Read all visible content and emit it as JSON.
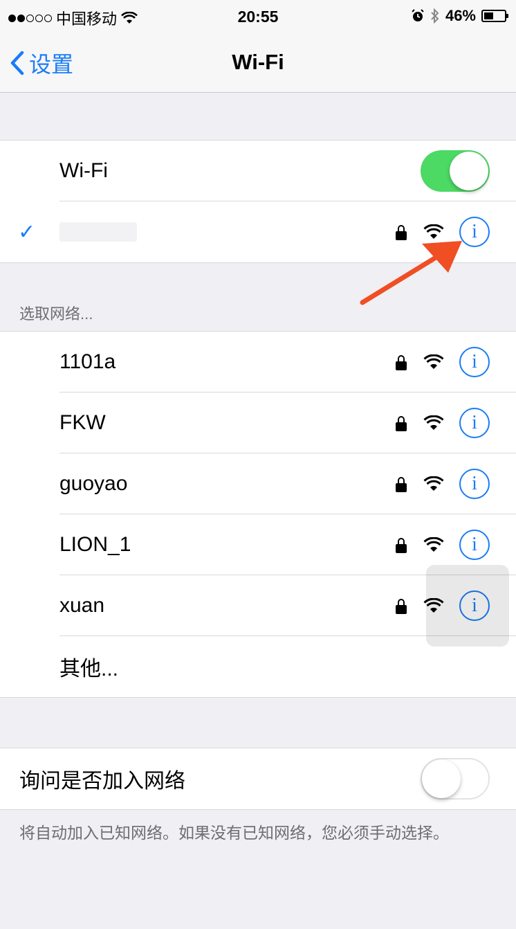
{
  "status_bar": {
    "carrier": "中国移动",
    "time": "20:55",
    "battery": "46%",
    "battery_level": 0.46
  },
  "nav": {
    "back_label": "设置",
    "title": "Wi-Fi"
  },
  "wifi_toggle": {
    "label": "Wi-Fi",
    "on": true
  },
  "connected": {
    "name_masked": true,
    "secured": true
  },
  "section_header": "选取网络...",
  "networks": [
    {
      "name": "1101a",
      "secured": true
    },
    {
      "name": "FKW",
      "secured": true
    },
    {
      "name": "guoyao",
      "secured": true
    },
    {
      "name": "LION_1",
      "secured": true
    },
    {
      "name": "xuan",
      "secured": true
    }
  ],
  "other_label": "其他...",
  "ask_join": {
    "label": "询问是否加入网络",
    "on": false
  },
  "footer": "将自动加入已知网络。如果没有已知网络，您必须手动选择。",
  "colors": {
    "accent": "#1a7cf6",
    "toggle_on": "#4cd964",
    "annotation_arrow": "#f04e23"
  }
}
